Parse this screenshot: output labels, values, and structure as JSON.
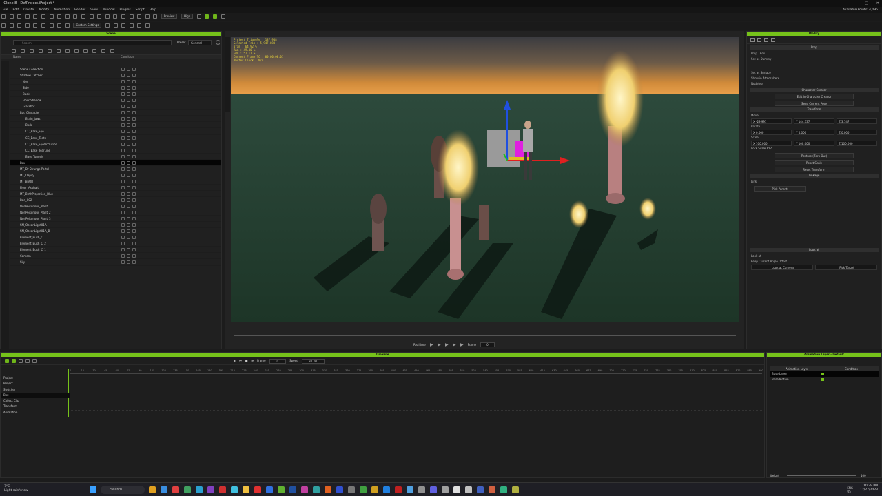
{
  "window": {
    "title": "iClone 8 - DefProject.iProject *",
    "available_points": "Available Points: 4,095"
  },
  "menu": [
    "File",
    "Edit",
    "Create",
    "Modify",
    "Animation",
    "Render",
    "View",
    "Window",
    "Plugins",
    "Script",
    "Help"
  ],
  "toolbar": {
    "preview_label": "Preview",
    "quality_label": "High",
    "custom_settings": "Custom Settings"
  },
  "scene": {
    "title": "Scene",
    "search_placeholder": "Search",
    "preset_label": "Preset",
    "preset_value": "General",
    "col_name": "Name",
    "col_condition": "Condition",
    "items": [
      "Scene Collection",
      "Shadow Catcher",
      "Key",
      "Side",
      "Back",
      "Floor Shadow",
      "Glassbot",
      "Bad Character",
      "Brain_Jaws",
      "Bodo",
      "CC_Base_Eye",
      "CC_Base_Teeth",
      "CC_Base_EyeOcclusion",
      "CC_Base_TearLine",
      "Base Tunnels",
      "Box",
      "MT_Dr Strange Portal",
      "MT_Dapify",
      "MT_BoOB",
      "Floor_Asphalt",
      "MT_BirthProjection_Blue",
      "Bad_002",
      "NonPoisonous_Plant",
      "NonPoisonous_Plant_2",
      "NonPoisonous_Plant_3",
      "SM_OceanLight01A",
      "SM_OceanLight01A_B",
      "Element_Bush_C",
      "Element_Bush_C_2",
      "Element_Bush_C_1",
      "Camera",
      "Sky"
    ]
  },
  "viewport": {
    "hud": [
      "Project Triangle : 187,948",
      "Selected Tris : 5,947,080",
      "Vram : 64.92 %",
      "Ram : 49.40 %",
      "GPU : 57.11 %",
      "Current Frame TC : 00:00:00:01",
      "Master Clock : N/A"
    ],
    "realtime_label": "Realtime",
    "frame_label": "Frame",
    "frame_value": "0"
  },
  "modify": {
    "title": "Modify",
    "prop_section": "Prop",
    "prop_label": "Prop",
    "prop_value": "Box",
    "set_as_dummy": "Set as Dummy",
    "set_as_surface": "Set as Surface",
    "show_in_atmosphere": "Show in Atmosphere",
    "nodeless": "Nodeless",
    "cc_section": "Character Creator",
    "edit_in_cc": "Edit in Character Creator",
    "send_pose": "Send Current Pose",
    "transform_section": "Transform",
    "move_label": "Move",
    "rotate_label": "Rotate",
    "scale_label": "Scale",
    "move": [
      "X  -29.991",
      "Y  144.737",
      "Z  3.747"
    ],
    "rotate": [
      "X  0.000",
      "Y  0.000",
      "Z  0.000"
    ],
    "scale": [
      "X  100.000",
      "Y  100.000",
      "Z  100.000"
    ],
    "lock_scale": "Lock Scale XYZ",
    "restore": "Restore (Zero Out)",
    "reset_scale": "Reset Scale",
    "reset_transform": "Reset Transform",
    "linkage_section": "Linkage",
    "link_label": "Link",
    "pick_parent": "Pick Parent",
    "lookat_section": "Look at",
    "lookat_label": "Look at",
    "keep_offset": "Keep Current Angle Offset",
    "look_at_camera": "Look at Camera",
    "pick_target": "Pick Target"
  },
  "timeline": {
    "title": "Timeline",
    "frame_label": "Frame",
    "frame_value": "0",
    "speed_label": "Speed",
    "speed_value": "x1.00",
    "rows": [
      "Project",
      "Project",
      "Switcher",
      "Box",
      "Collect Clip",
      "Transform",
      "Animation"
    ],
    "ticks": [
      "0",
      "15",
      "30",
      "45",
      "60",
      "75",
      "90",
      "105",
      "120",
      "135",
      "150",
      "165",
      "180",
      "195",
      "210",
      "225",
      "240",
      "255",
      "270",
      "285",
      "300",
      "315",
      "330",
      "345",
      "360",
      "375",
      "390",
      "405",
      "420",
      "435",
      "450",
      "465",
      "480",
      "495",
      "510",
      "525",
      "540",
      "555",
      "570",
      "585",
      "600",
      "615",
      "630",
      "645",
      "660",
      "675",
      "690",
      "705",
      "720",
      "735",
      "750",
      "765",
      "780",
      "795",
      "810",
      "825",
      "840",
      "855",
      "870",
      "885",
      "900"
    ]
  },
  "anim_layer": {
    "title": "Animation Layer - Default",
    "col_layer": "Animation Layer",
    "col_condition": "Condition",
    "rows": [
      "Base Layer",
      "Base Motion"
    ],
    "weight_label": "Weight",
    "weight_value": "100"
  },
  "taskbar": {
    "weather_temp": "7°C",
    "weather_desc": "Light rain/snow",
    "search_label": "Search",
    "lang": "ENG\nUS",
    "time": "10:29 PM",
    "date": "12/27/2023"
  },
  "colors": {
    "accent": "#76c21a",
    "hud_text": "#e6d23a"
  }
}
